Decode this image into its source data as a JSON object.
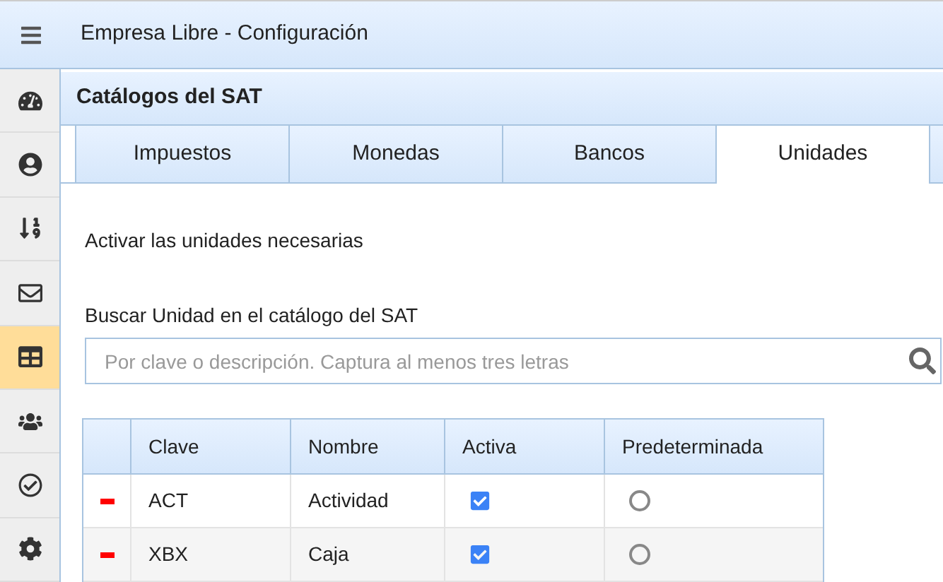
{
  "window": {
    "title": "Empresa Libre - Configuración"
  },
  "sidebar": {
    "items": [
      {
        "selected": false
      },
      {
        "selected": false
      },
      {
        "selected": false
      },
      {
        "selected": false
      },
      {
        "selected": true
      },
      {
        "selected": false
      },
      {
        "selected": false
      },
      {
        "selected": false
      }
    ]
  },
  "panel": {
    "title": "Catálogos del SAT"
  },
  "tabs": [
    {
      "label": "Impuestos",
      "selected": false
    },
    {
      "label": "Monedas",
      "selected": false
    },
    {
      "label": "Bancos",
      "selected": false
    },
    {
      "label": "Unidades",
      "selected": true
    }
  ],
  "intro": "Activar las unidades necesarias",
  "search": {
    "label": "Buscar Unidad en el catálogo del SAT",
    "placeholder": "Por clave o descripción. Captura al menos tres letras"
  },
  "table": {
    "columns": [
      "Clave",
      "Nombre",
      "Activa",
      "Predeterminada"
    ],
    "rows": [
      {
        "clave": "ACT",
        "nombre": "Actividad",
        "activa": true,
        "predeterminada": false
      },
      {
        "clave": "XBX",
        "nombre": "Caja",
        "activa": true,
        "predeterminada": false
      }
    ]
  }
}
